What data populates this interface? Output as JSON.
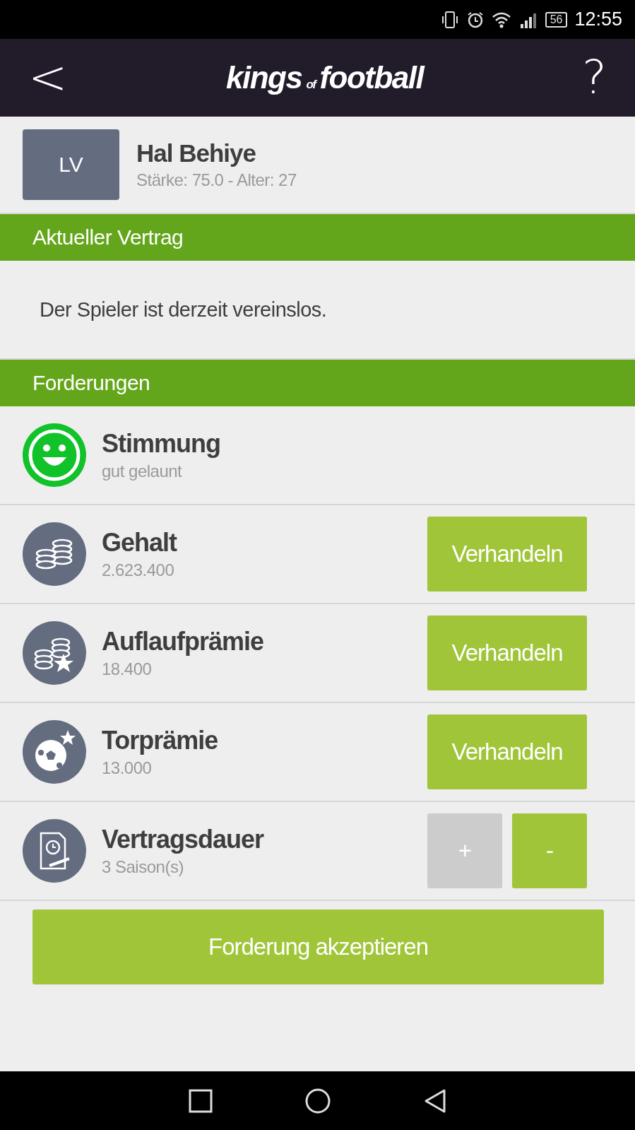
{
  "status_bar": {
    "battery": "56",
    "time": "12:55"
  },
  "header": {
    "back": "<",
    "logo": [
      "kings",
      "of",
      "football"
    ],
    "help": "?"
  },
  "player": {
    "position": "LV",
    "name": "Hal Behiye",
    "details": "Stärke: 75.0 - Alter: 27"
  },
  "contract": {
    "title": "Aktueller Vertrag",
    "text": "Der Spieler ist derzeit vereinslos."
  },
  "demands": {
    "title": "Forderungen",
    "rows": [
      {
        "kind": "mood",
        "label": "Stimmung",
        "value": "gut gelaunt"
      },
      {
        "kind": "salary",
        "label": "Gehalt",
        "value": "2.623.400",
        "button": "Verhandeln"
      },
      {
        "kind": "bonus",
        "label": "Auflaufprämie",
        "value": "18.400",
        "button": "Verhandeln"
      },
      {
        "kind": "goal",
        "label": "Torprämie",
        "value": "13.000",
        "button": "Verhandeln"
      },
      {
        "kind": "duration",
        "label": "Vertragsdauer",
        "value": "3 Saison(s)",
        "stepper": [
          {
            "label": "+",
            "disabled": true
          },
          {
            "label": "-",
            "disabled": false
          }
        ]
      }
    ]
  },
  "accept_button": "Forderung akzeptieren"
}
